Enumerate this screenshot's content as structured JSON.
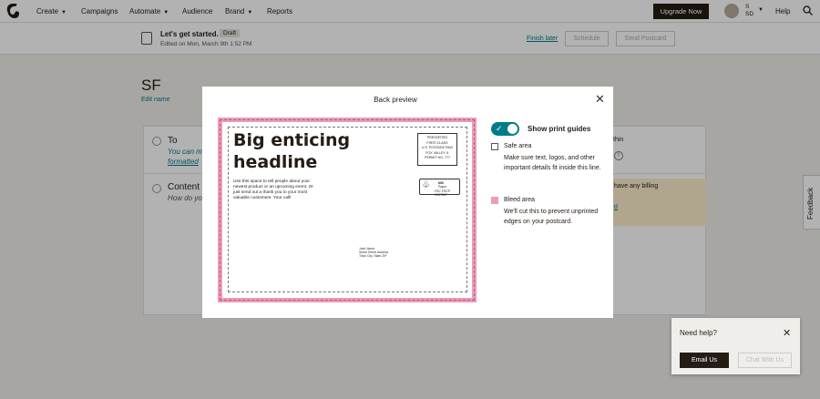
{
  "nav": {
    "items": [
      "Create",
      "Campaigns",
      "Automate",
      "Audience",
      "Brand",
      "Reports"
    ],
    "upgrade_label": "Upgrade Now",
    "account_line1": "S",
    "account_line2": "SD",
    "help_label": "Help"
  },
  "subheader": {
    "title": "Let's get started.",
    "draft_badge": "Draft",
    "edited": "Edited on Mon, March 9th 1:52 PM",
    "finish_later": "Finish later",
    "schedule": "Schedule",
    "send": "Send Postcard"
  },
  "page": {
    "title": "SF",
    "edit_name": "Edit name"
  },
  "checklist": {
    "to": {
      "title": "To",
      "desc_line1": "You can m",
      "desc_line2": "formatted"
    },
    "content": {
      "title": "Content",
      "desc": "How do yo"
    },
    "right_fragment_1": "thin",
    "right_fragment_2": "have any billing",
    "right_fragment_3": "d"
  },
  "feedback_label": "Feedback",
  "modal": {
    "title": "Back preview",
    "show_print_guides": "Show print guides",
    "safe_area_title": "Safe area",
    "safe_area_desc": "Make sure text, logos, and other important details fit inside this line.",
    "bleed_area_title": "Bleed area",
    "bleed_area_desc": "We'll cut this to prevent unprinted edges on your postcard.",
    "bleed_color": "#eb9bbd",
    "toggle_on": true
  },
  "postcard": {
    "headline": "Big enticing headline",
    "body": "Use this space to tell people about your newest product or an upcoming event. Or just send out a thank you to your most valuable customers. Your call!",
    "postage": [
      "PRESORTED",
      "FIRST-CLASS",
      "U.S. POSTAGE PAID",
      "FOX VALLEY IL",
      "PERMIT NO. 777"
    ],
    "fsc_mix": "MIX",
    "fsc_paper": "Paper",
    "fsc_code": "FSC   FSC® C107897",
    "address": [
      "Josh Name",
      "Street Street Address",
      "Town City, State ZIP"
    ]
  },
  "help_panel": {
    "title": "Need help?",
    "email": "Email Us",
    "chat": "Chat With Us"
  }
}
